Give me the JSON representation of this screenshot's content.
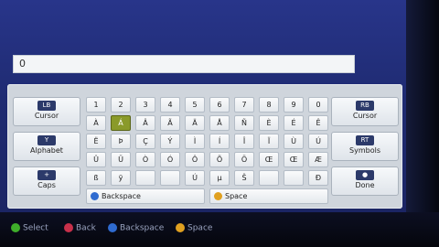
{
  "input": {
    "value": "0"
  },
  "left_buttons": [
    {
      "label": "Cursor",
      "icon": "LB",
      "name": "cursor-left-button"
    },
    {
      "label": "Alphabet",
      "icon": "Y",
      "name": "alphabet-button"
    },
    {
      "label": "Caps",
      "icon": "+",
      "name": "caps-button"
    }
  ],
  "right_buttons": [
    {
      "label": "Cursor",
      "icon": "RB",
      "name": "cursor-right-button"
    },
    {
      "label": "Symbols",
      "icon": "RT",
      "name": "symbols-button"
    },
    {
      "label": "Done",
      "icon": "●",
      "name": "done-button"
    }
  ],
  "keys": [
    [
      "1",
      "2",
      "3",
      "4",
      "5",
      "6",
      "7",
      "8",
      "9",
      "0"
    ],
    [
      "À",
      "Á",
      "Â",
      "Ã",
      "Ä",
      "Å",
      "Ñ",
      "È",
      "É",
      "Ê"
    ],
    [
      "Ë",
      "Þ",
      "Ç",
      "Ý",
      "Ì",
      "Í",
      "Î",
      "Ï",
      "Ù",
      "Ú"
    ],
    [
      "Û",
      "Ü",
      "Ò",
      "Ó",
      "Ô",
      "Õ",
      "Ö",
      "Œ",
      "Œ",
      "Æ"
    ],
    [
      "ß",
      "ÿ",
      "",
      "",
      "Ú",
      "µ",
      "Š",
      "",
      "",
      "Ð"
    ]
  ],
  "selected_key": {
    "row": 1,
    "col": 1
  },
  "backspace": {
    "label": "Backspace"
  },
  "space": {
    "label": "Space"
  },
  "legend": [
    {
      "label": "Select",
      "color": "#3fae2a"
    },
    {
      "label": "Back",
      "color": "#c8304a"
    },
    {
      "label": "Backspace",
      "color": "#2f6bd0"
    },
    {
      "label": "Space",
      "color": "#e0a020"
    }
  ]
}
